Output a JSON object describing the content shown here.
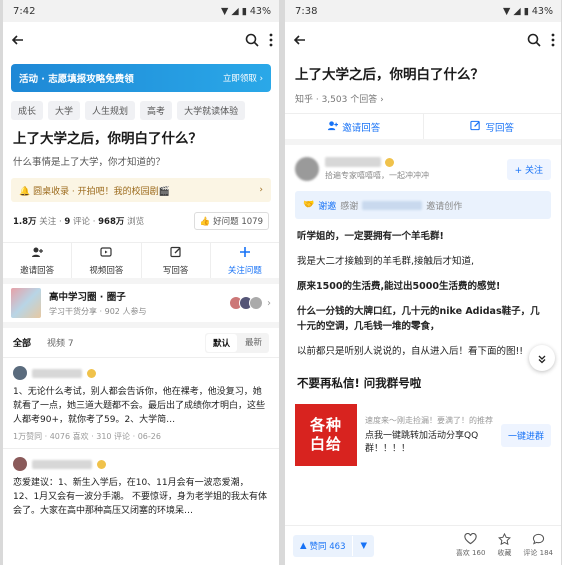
{
  "left": {
    "status": {
      "time": "7:42",
      "battery": "43%"
    },
    "banner": {
      "text": "活动 · 志愿填报攻略免费领",
      "action": "立即领取 ›"
    },
    "tags": [
      "成长",
      "大学",
      "人生规划",
      "高考",
      "大学就读体验"
    ],
    "question": {
      "title": "上了大学之后，你明白了什么？",
      "desc": "什么事情是上了大学，你才知道的？"
    },
    "campus": {
      "text": "🔔 圆桌收录 · 开拍吧！我的校园剧🎬",
      "arrow": "›"
    },
    "stats": {
      "followers": "1.8万",
      "followers_label": "关注",
      "comments": "9",
      "comments_label": "评论",
      "views": "968万",
      "views_label": "浏览",
      "good_question": "好问题 1079"
    },
    "actions": [
      "邀请回答",
      "视频回答",
      "写回答",
      "关注问题"
    ],
    "circle": {
      "name": "高中学习圈 · 圈子",
      "sub": "学习干货分享 · 902 人参与"
    },
    "tabs": {
      "all": "全部",
      "video": "视频 7",
      "default": "默认",
      "latest": "最新"
    },
    "answers": [
      {
        "text": "1、无论什么考试，别人都会告诉你，他在裸考，他没复习，她就看了一点，她三道大题都不会。最后出了成绩你才明白，这些人都考90+，就你考了59。2、大学简…",
        "meta": "1万赞同 · 4076 喜欢 · 310 评论 · 06-26"
      },
      {
        "text": "恋爱建议：1、新生入学后，在10、11月会有一波恋爱潮，12、1月又会有一波分手潮。 不要惊讶，身为老学姐的我太有体会了。大家在高中那种高压又闭塞的环境呆…",
        "meta": ""
      }
    ]
  },
  "right": {
    "status": {
      "time": "7:38",
      "battery": "43%"
    },
    "question": {
      "title": "上了大学之后，你明白了什么？",
      "meta": "知乎 · 3,503 个回答 ›"
    },
    "actions": [
      "邀请回答",
      "写回答"
    ],
    "author": {
      "sub": "拾遍专家嘻嘻嘻，一起冲冲冲",
      "follow": "+ 关注"
    },
    "invite": {
      "thanks": "谢邀",
      "thanks_to": "感谢",
      "created": "邀请创作"
    },
    "paragraphs": [
      {
        "text": "听学姐的，一定要拥有一个羊毛群!",
        "bold": true
      },
      {
        "text": "我是大二才接触到的羊毛群,接触后才知道,",
        "bold": false
      },
      {
        "text": "原来1500的生活费,能过出5000生活费的感觉!",
        "bold": true
      },
      {
        "text": "什么一分钱的大牌口红，几十元的nike Adidas鞋子，几十元的空调，几毛钱一堆的零食，",
        "bold": true
      },
      {
        "text": "以前都只是听别人说说的，自从进入后！看下面的图!!",
        "bold": false
      }
    ],
    "section_title": "不要再私信! 问我群号啦",
    "ad": {
      "image_text_1": "各种",
      "image_text_2": "白给",
      "top": "速度来～刚走捡漏！要满了！的推荐",
      "body": "点我一键跳转加活动分享QQ群！！！！",
      "button": "一键进群"
    },
    "bottom": {
      "vote": "赞同 463",
      "like": "喜欢 160",
      "fav": "收藏",
      "comment": "评论 184"
    }
  }
}
